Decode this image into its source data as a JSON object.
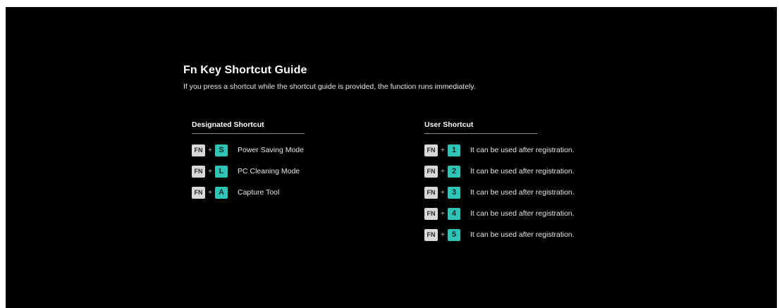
{
  "guide": {
    "title": "Fn Key Shortcut Guide",
    "subtitle": "If you press a shortcut while the shortcut guide is provided, the function runs immediately."
  },
  "designated": {
    "header": "Designated Shortcut",
    "items": [
      {
        "fn": "FN",
        "plus": "+",
        "key": "S",
        "label": "Power Saving Mode"
      },
      {
        "fn": "FN",
        "plus": "+",
        "key": "L",
        "label": "PC Cleaning Mode"
      },
      {
        "fn": "FN",
        "plus": "+",
        "key": "A",
        "label": "Capture Tool"
      }
    ]
  },
  "user": {
    "header": "User Shortcut",
    "items": [
      {
        "fn": "FN",
        "plus": "+",
        "key": "1",
        "label": "It can be used after registration."
      },
      {
        "fn": "FN",
        "plus": "+",
        "key": "2",
        "label": "It can be used after registration."
      },
      {
        "fn": "FN",
        "plus": "+",
        "key": "3",
        "label": "It can be used after registration."
      },
      {
        "fn": "FN",
        "plus": "+",
        "key": "4",
        "label": "It can be used after registration."
      },
      {
        "fn": "FN",
        "plus": "+",
        "key": "5",
        "label": "It can be used after registration."
      }
    ]
  },
  "colors": {
    "background": "#000000",
    "accent_key": "#2ec4b6",
    "fn_key": "#d9d9d9"
  }
}
